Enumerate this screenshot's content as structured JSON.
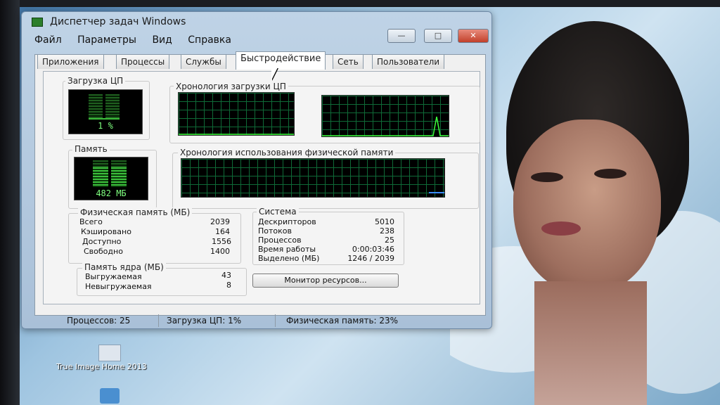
{
  "window": {
    "title": "Диспетчер задач Windows",
    "controls": {
      "minimize": "—",
      "maximize": "□",
      "close": "✕"
    }
  },
  "menu": [
    "Файл",
    "Параметры",
    "Вид",
    "Справка"
  ],
  "tabs": [
    "Приложения",
    "Процессы",
    "Службы",
    "Быстродействие",
    "Сеть",
    "Пользователи"
  ],
  "active_tab": "Быстродействие",
  "cpu": {
    "title": "Загрузка ЦП",
    "value": "1 %",
    "history_title": "Хронология загрузки ЦП"
  },
  "memory": {
    "title": "Память",
    "value": "482 МБ",
    "history_title": "Хронология использования физической памяти"
  },
  "physical": {
    "title": "Физическая память (МБ)",
    "rows": [
      {
        "label": "Всего",
        "value": "2039"
      },
      {
        "label": "Кэшировано",
        "value": "164"
      },
      {
        "label": "Доступно",
        "value": "1556"
      },
      {
        "label": "Свободно",
        "value": "1400"
      }
    ]
  },
  "kernel": {
    "title": "Память ядра (МБ)",
    "rows": [
      {
        "label": "Выгружаемая",
        "value": "43"
      },
      {
        "label": "Невыгружаемая",
        "value": "8"
      }
    ]
  },
  "system": {
    "title": "Система",
    "rows": [
      {
        "label": "Дескрипторов",
        "value": "5010"
      },
      {
        "label": "Потоков",
        "value": "238"
      },
      {
        "label": "Процессов",
        "value": "25"
      },
      {
        "label": "Время работы",
        "value": "0:00:03:46"
      },
      {
        "label": "Выделено (МБ)",
        "value": "1246 / 2039"
      }
    ]
  },
  "resource_monitor_button": "Монитор ресурсов...",
  "status": {
    "processes": "Процессов: 25",
    "cpu": "Загрузка ЦП: 1%",
    "memory": "Физическая память: 23%"
  },
  "desktop": {
    "icon_label": "True Image Home 2013"
  },
  "colors": {
    "graph_line": "#3cff3c",
    "grid": "#0f6a37",
    "window_frame": "#bfd3e6"
  }
}
